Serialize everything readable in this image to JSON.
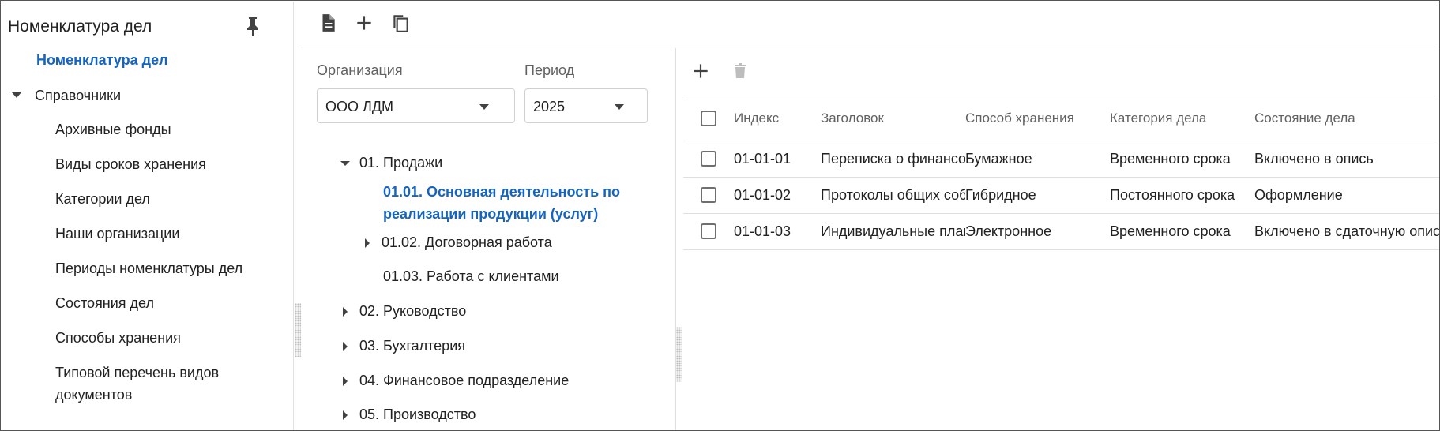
{
  "sidebar": {
    "title": "Номенклатура дел",
    "active_item": "Номенклатура дел",
    "group_label": "Справочники",
    "items": [
      "Архивные фонды",
      "Виды сроков хранения",
      "Категории дел",
      "Наши организации",
      "Периоды номенклатуры дел",
      "Состояния дел",
      "Способы хранения",
      "Типовой перечень видов документов"
    ]
  },
  "filters": {
    "organization_label": "Организация",
    "organization_value": "ООО ЛДМ",
    "period_label": "Период",
    "period_value": "2025"
  },
  "tree": {
    "n01": "01. Продажи",
    "n0101": "01.01. Основная деятельность по реализации продукции (услуг)",
    "n0102": "01.02. Договорная работа",
    "n0103": "01.03. Работа с клиентами",
    "n02": "02. Руководство",
    "n03": "03. Бухгалтерия",
    "n04": "04. Финансовое подразделение",
    "n05": "05. Производство"
  },
  "grid": {
    "columns": [
      "Индекс",
      "Заголовок",
      "Способ хранения",
      "Категория дела",
      "Состояние дела"
    ],
    "rows": [
      [
        "01-01-01",
        "Переписка о финансовых",
        "Бумажное",
        "Временного срока",
        "Включено в опись"
      ],
      [
        "01-01-02",
        "Протоколы общих собраний",
        "Гибридное",
        "Постоянного срока",
        "Оформление"
      ],
      [
        "01-01-03",
        "Индивидуальные планы",
        "Электронное",
        "Временного срока",
        "Включено в сдаточную опись"
      ]
    ]
  },
  "colors": {
    "accent": "#1565c0",
    "text": "#212121",
    "muted": "#616161",
    "border": "#e0e0e0"
  }
}
